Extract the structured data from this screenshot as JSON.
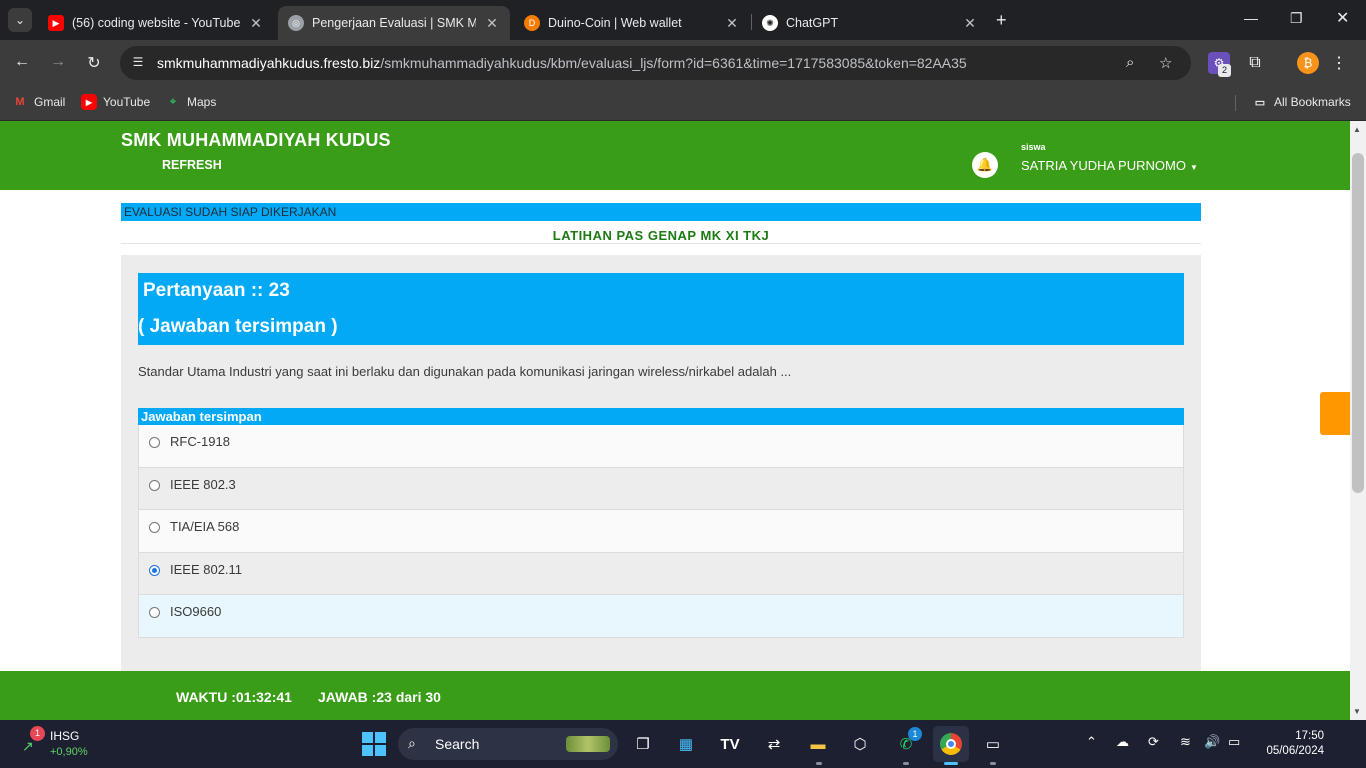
{
  "browser": {
    "tabs": [
      {
        "title": "(56) coding website - YouTube",
        "active": false,
        "favicon_color": "#ff0000"
      },
      {
        "title": "Pengerjaan Evaluasi | SMK MUH",
        "active": true,
        "favicon_color": "#9aa0a6"
      },
      {
        "title": "Duino-Coin | Web wallet",
        "active": false,
        "favicon_color": "#f57c00"
      },
      {
        "title": "ChatGPT",
        "active": false,
        "favicon_color": "#ffffff"
      }
    ],
    "url_host": "smkmuhammadiyahkudus.fresto.biz",
    "url_path": "/smkmuhammadiyahkudus/kbm/evaluasi_ljs/form?id=6361&time=1717583085&token=82AA35",
    "extension_badge": "2",
    "bookmarks": [
      {
        "label": "Gmail",
        "icon": "gmail-icon"
      },
      {
        "label": "YouTube",
        "icon": "youtube-icon"
      },
      {
        "label": "Maps",
        "icon": "maps-icon"
      }
    ],
    "all_bookmarks": "All Bookmarks"
  },
  "header": {
    "school": "SMK MUHAMMADIYAH KUDUS",
    "refresh": "REFRESH",
    "role": "siswa",
    "user": "SATRIA YUDHA PURNOMO"
  },
  "notice": "EVALUASI SUDAH SIAP DIKERJAKAN",
  "exam_title": "LATIHAN PAS GENAP MK XI TKJ",
  "question": {
    "number_label": "Pertanyaan :: 23",
    "status": "( Jawaban tersimpan )",
    "text": "Standar Utama Industri yang saat ini berlaku dan digunakan pada komunikasi jaringan wireless/nirkabel  adalah ...",
    "answer_label": "Jawaban tersimpan",
    "options": [
      {
        "label": "RFC-1918",
        "selected": false
      },
      {
        "label": "IEEE 802.3",
        "selected": false
      },
      {
        "label": "TIA/EIA 568",
        "selected": false
      },
      {
        "label": "IEEE 802.11",
        "selected": true
      },
      {
        "label": "ISO9660",
        "selected": false
      }
    ]
  },
  "footer": {
    "waktu_label": "WAKTU :",
    "waktu": "01:32:41",
    "jawab_label": "JAWAB :",
    "jawab_count": "23",
    "jawab_total": "dari 30"
  },
  "taskbar": {
    "stock_name": "IHSG",
    "stock_change": "+0,90%",
    "stock_badge": "1",
    "search_label": "Search",
    "whatsapp_badge": "1",
    "time": "17:50",
    "date": "05/06/2024"
  },
  "colors": {
    "header_green": "#3a9d17",
    "accent_blue": "#03a9f4",
    "title_green": "#1d7a14",
    "float_orange": "#ff9800"
  }
}
